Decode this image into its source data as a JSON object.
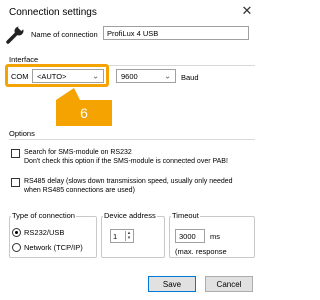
{
  "window": {
    "title": "Connection settings",
    "close_glyph": "✕"
  },
  "connection": {
    "name_label": "Name of connection",
    "name_value": "ProfiLux 4 USB",
    "icon": "wrench-icon"
  },
  "interface": {
    "group_label": "Interface",
    "com_label": "COM",
    "com_value": "<AUTO>",
    "baud_value": "9600",
    "baud_label": "Baud"
  },
  "annotation": {
    "badge_number": "6",
    "highlight_color": "#f5a300"
  },
  "options": {
    "group_label": "Options",
    "sms_line1": "Search for SMS-module on RS232",
    "sms_line2": "Don't check this option if the SMS-module is connected over PAB!",
    "rs485_line1": "RS485 delay (slows down transmission speed, usually only needed",
    "rs485_line2": "when RS485 connections are used)"
  },
  "connection_type": {
    "group_label": "Type of connection",
    "rs232_label": "RS232/USB",
    "network_label": "Network (TCP/IP)",
    "selected": "RS232/USB"
  },
  "device_address": {
    "group_label": "Device address",
    "value": "1"
  },
  "timeout": {
    "group_label": "Timeout",
    "value": "3000",
    "unit": "ms",
    "note": "(max. response"
  },
  "buttons": {
    "save": "Save",
    "cancel": "Cancel"
  }
}
